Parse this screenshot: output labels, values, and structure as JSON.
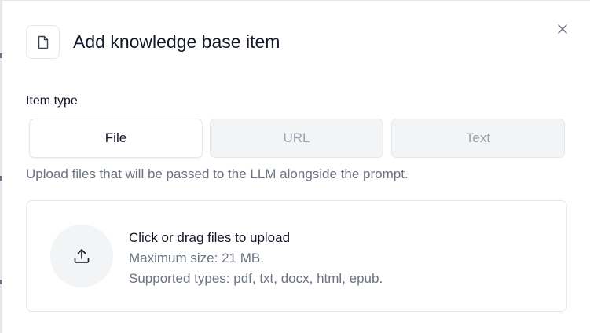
{
  "dialog": {
    "title": "Add knowledge base item",
    "header_icon": "document-icon",
    "close_icon": "close-icon"
  },
  "item_type": {
    "label": "Item type",
    "tabs": [
      {
        "label": "File",
        "active": true
      },
      {
        "label": "URL",
        "active": false
      },
      {
        "label": "Text",
        "active": false
      }
    ]
  },
  "helper_text": "Upload files that will be passed to the LLM alongside the prompt.",
  "dropzone": {
    "icon": "upload-icon",
    "title": "Click or drag files to upload",
    "max_size": "Maximum size: 21 MB.",
    "supported_types": "Supported types: pdf, txt, docx, html, epub."
  },
  "colors": {
    "border": "#e5e7eb",
    "muted_text": "#6b7280",
    "inactive_tab_bg": "#f3f4f6",
    "inactive_tab_text": "#9ca3af"
  }
}
